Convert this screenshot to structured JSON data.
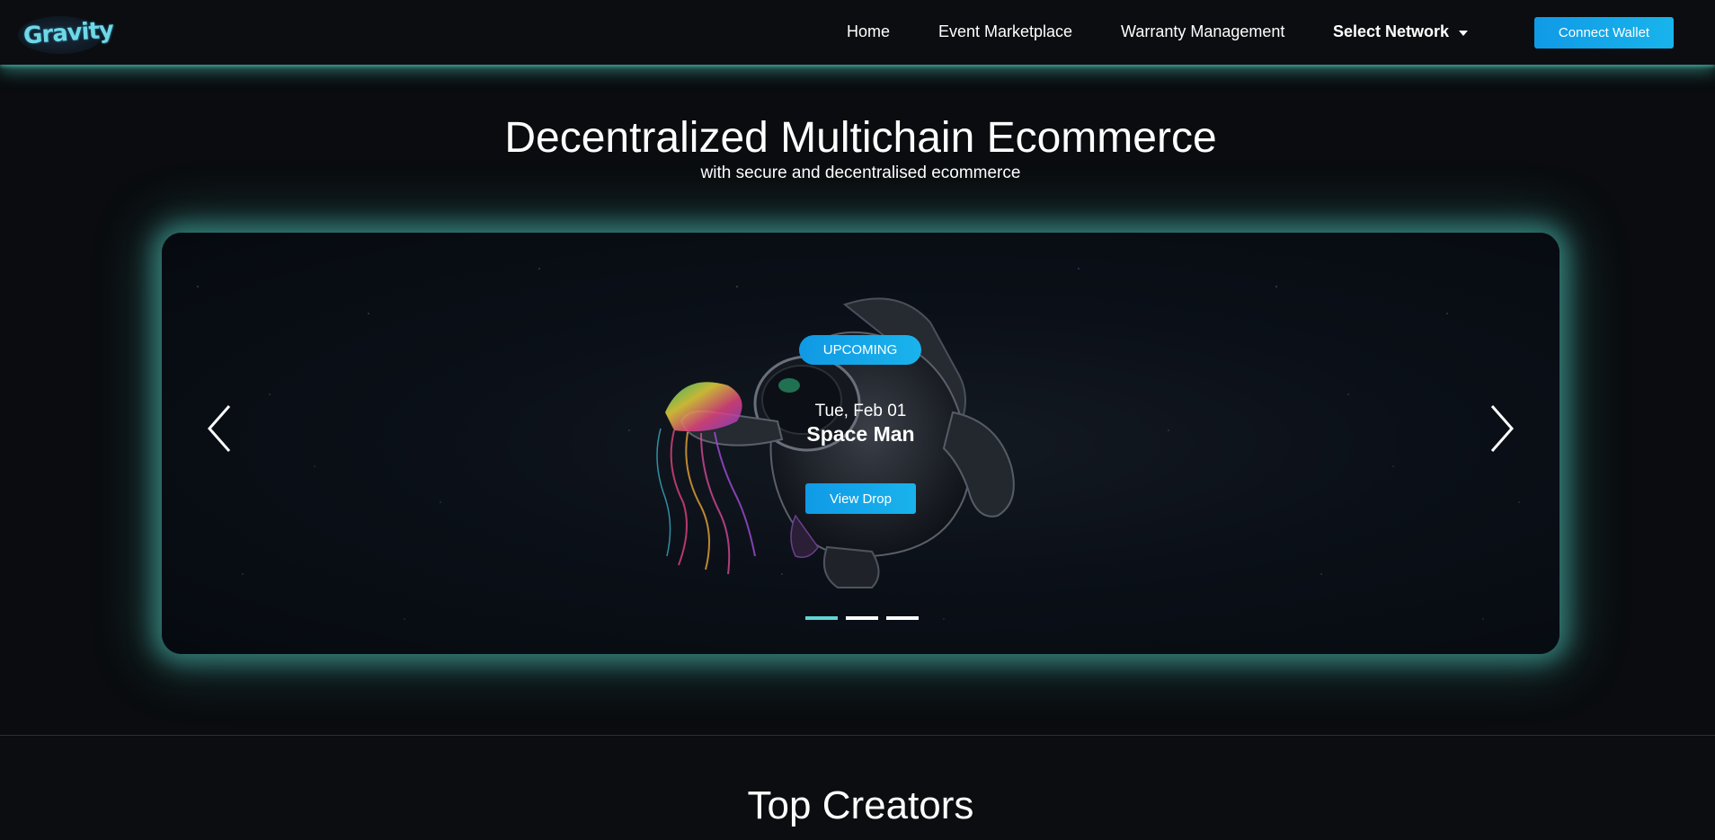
{
  "brand": {
    "logo_text": "Gravity"
  },
  "nav": {
    "items": [
      {
        "label": "Home"
      },
      {
        "label": "Event Marketplace"
      },
      {
        "label": "Warranty Management"
      }
    ],
    "network_label": "Select Network",
    "connect_label": "Connect Wallet"
  },
  "hero": {
    "title": "Decentralized Multichain Ecommerce",
    "subtitle": "with secure and decentralised ecommerce"
  },
  "carousel": {
    "badge": "UPCOMING",
    "date": "Tue, Feb 01",
    "title": "Space Man",
    "cta_label": "View Drop",
    "active_index": 0,
    "slide_count": 3
  },
  "sections": {
    "top_creators_title": "Top Creators"
  },
  "colors": {
    "accent": "#18a8ea",
    "glow": "#4cbeb2",
    "background": "#0a0c0f",
    "indicator_active": "#5fd6d4"
  }
}
